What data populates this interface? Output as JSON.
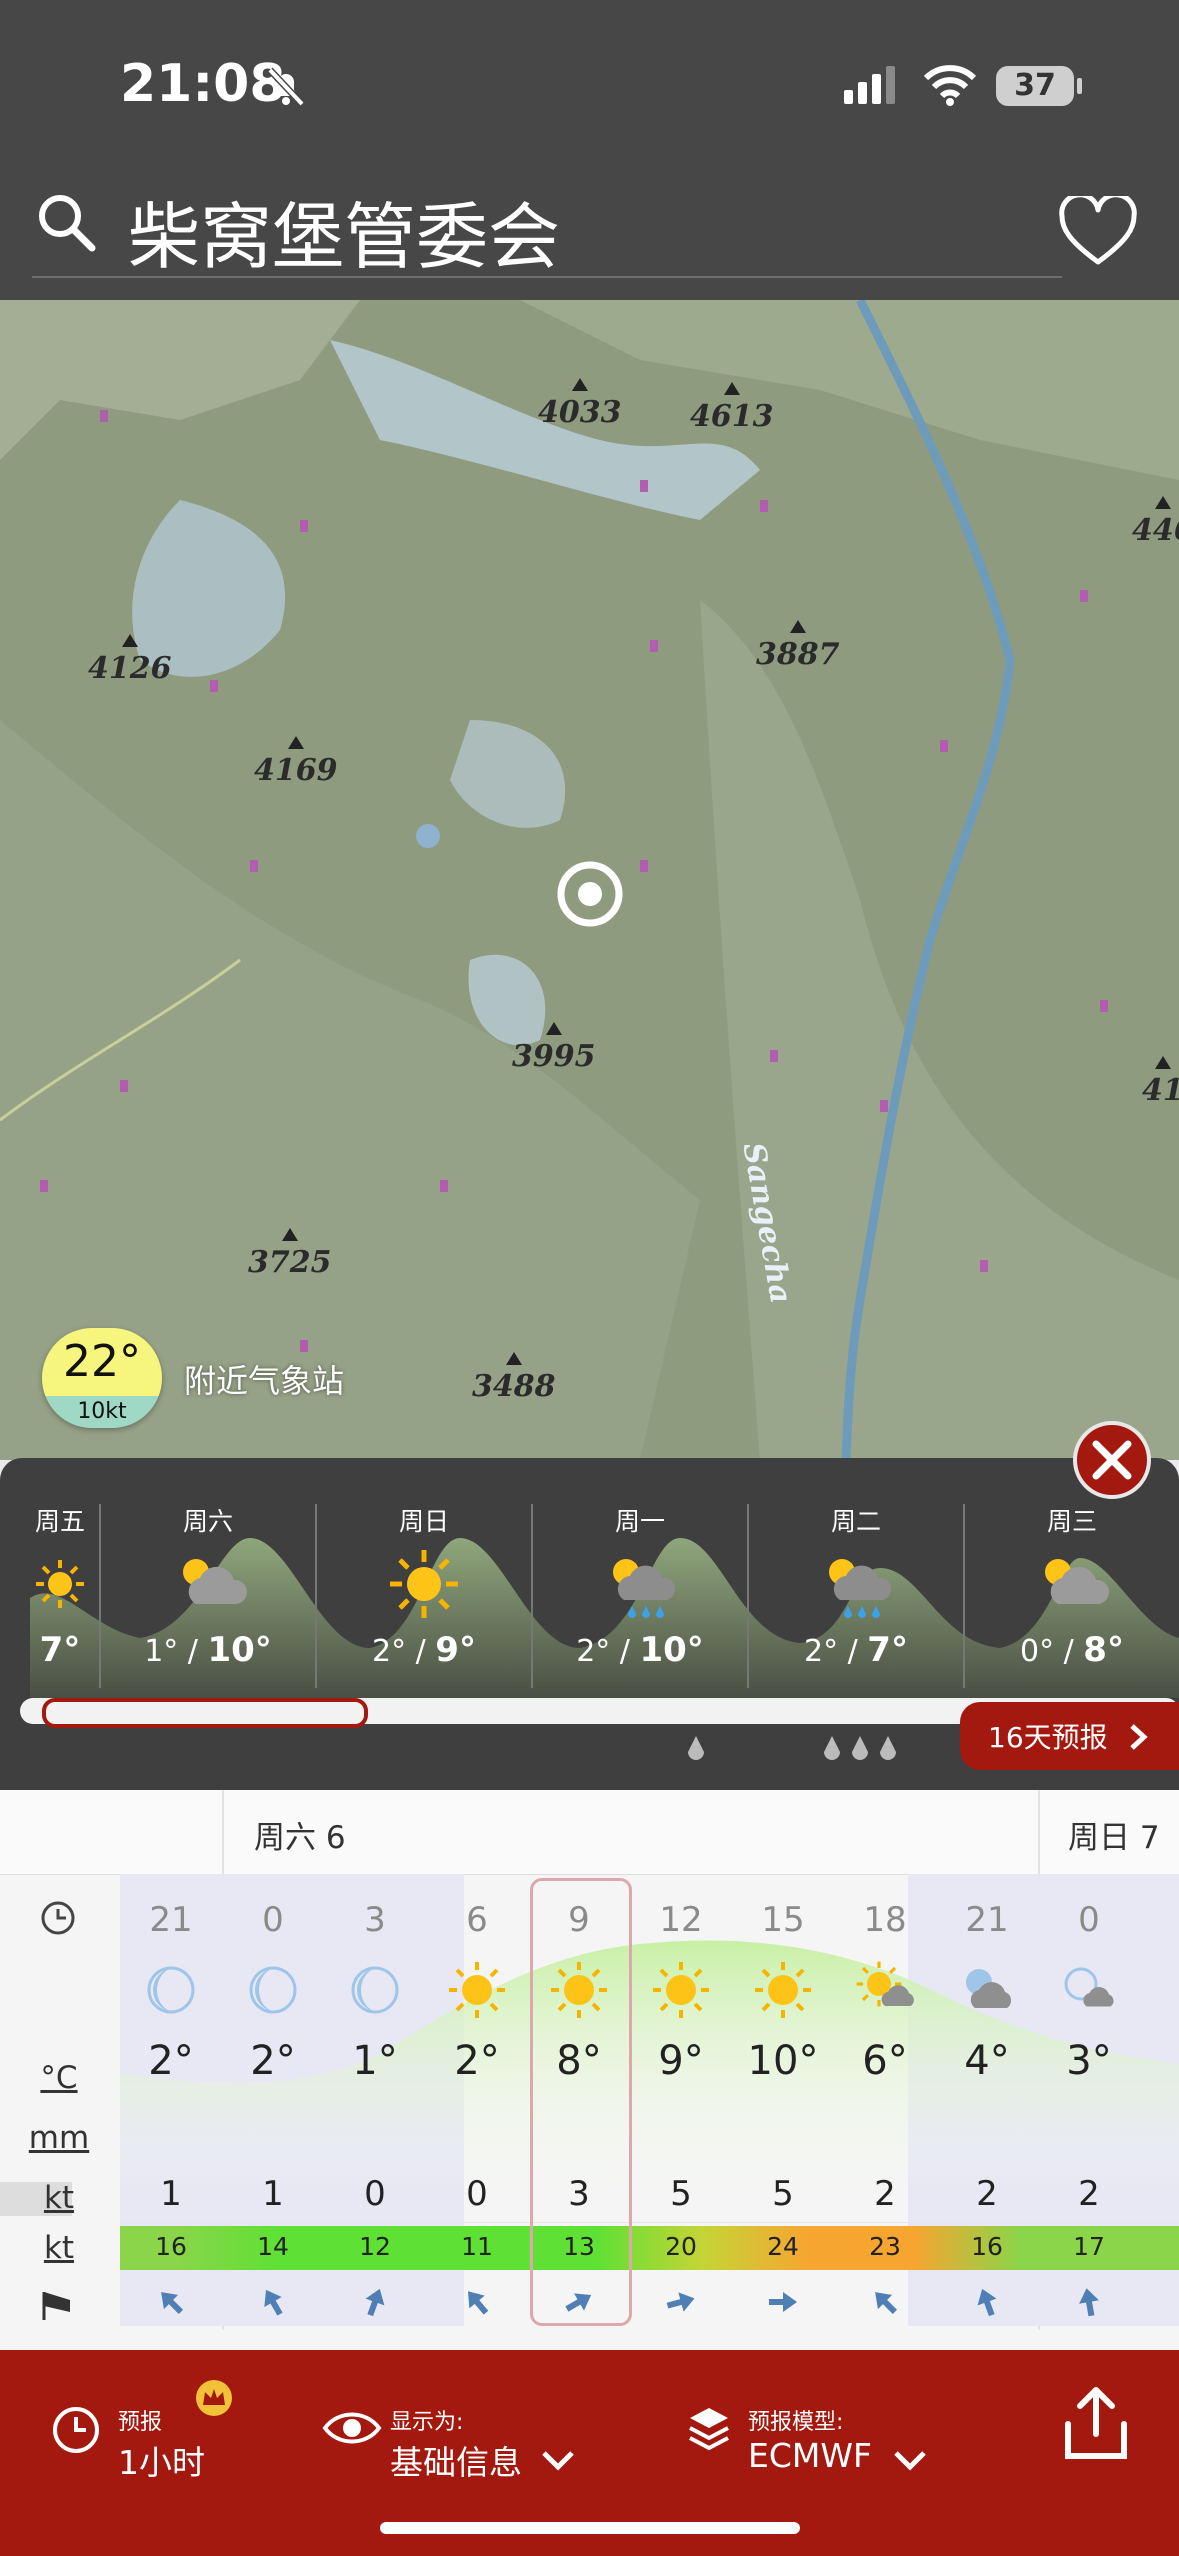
{
  "status": {
    "time": "21:08",
    "battery": "37"
  },
  "search": {
    "title": "柴窝堡管委会"
  },
  "map": {
    "peaks": [
      "4033",
      "4613",
      "446",
      "4126",
      "3887",
      "4169",
      "3995",
      "41",
      "3725",
      "3488"
    ],
    "river_label": "Sangecha",
    "station": {
      "temp": "22°",
      "wind": "10kt",
      "label": "附近气象站"
    }
  },
  "daily": {
    "days": [
      {
        "name": "周五",
        "low": "",
        "high": "7°",
        "icon": "sun-icon"
      },
      {
        "name": "周六",
        "low": "1° / ",
        "high": "10°",
        "icon": "partly-cloudy-icon"
      },
      {
        "name": "周日",
        "low": "2° / ",
        "high": "9°",
        "icon": "sun-icon"
      },
      {
        "name": "周一",
        "low": "2° / ",
        "high": "10°",
        "icon": "rain-icon"
      },
      {
        "name": "周二",
        "low": "2° / ",
        "high": "7°",
        "icon": "rain-icon"
      },
      {
        "name": "周三",
        "low": "0° / ",
        "high": "8°",
        "icon": "partly-cloudy-icon"
      }
    ],
    "forecast16_label": "16天预报"
  },
  "hourly": {
    "day_labels": [
      "周六 6",
      "周日 7"
    ],
    "row_labels": {
      "temp_unit": "°C",
      "precip_unit": "mm",
      "wind_unit": "kt",
      "gust_unit": "kt"
    },
    "hours": [
      {
        "hour": "21",
        "icon": "moon-icon",
        "temp": "2°",
        "wind": "1",
        "gust": "16",
        "gust_color": "#8bd54a",
        "dir": 315
      },
      {
        "hour": "0",
        "icon": "moon-icon",
        "temp": "2°",
        "wind": "1",
        "gust": "14",
        "gust_color": "#5fe034",
        "dir": 330
      },
      {
        "hour": "3",
        "icon": "moon-icon",
        "temp": "1°",
        "wind": "0",
        "gust": "12",
        "gust_color": "#5fe034",
        "dir": 20
      },
      {
        "hour": "6",
        "icon": "sun-icon",
        "temp": "2°",
        "wind": "0",
        "gust": "11",
        "gust_color": "#5fe034",
        "dir": 320
      },
      {
        "hour": "9",
        "icon": "sun-icon",
        "temp": "8°",
        "wind": "3",
        "gust": "13",
        "gust_color": "#5fe034",
        "dir": 60
      },
      {
        "hour": "12",
        "icon": "sun-icon",
        "temp": "9°",
        "wind": "5",
        "gust": "20",
        "gust_color": "#c5d436",
        "dir": 75
      },
      {
        "hour": "15",
        "icon": "sun-icon",
        "temp": "10°",
        "wind": "5",
        "gust": "24",
        "gust_color": "#f6a531",
        "dir": 90
      },
      {
        "hour": "18",
        "icon": "sun-cloud-icon",
        "temp": "6°",
        "wind": "2",
        "gust": "23",
        "gust_color": "#f6a531",
        "dir": 315
      },
      {
        "hour": "21",
        "icon": "cloudy-night-icon",
        "temp": "4°",
        "wind": "2",
        "gust": "16",
        "gust_color": "#8bd54a",
        "dir": 340
      },
      {
        "hour": "0",
        "icon": "moon-cloud-icon",
        "temp": "3°",
        "wind": "2",
        "gust": "17",
        "gust_color": "#8bd54a",
        "dir": 350
      }
    ]
  },
  "bottom": {
    "forecast_label": "预报",
    "forecast_value": "1小时",
    "display_label": "显示为:",
    "display_value": "基础信息",
    "model_label": "预报模型:",
    "model_value": "ECMWF"
  },
  "colors": {
    "header": "#474747",
    "accent_red": "#a3190f",
    "panel": "#3f3f3f"
  }
}
